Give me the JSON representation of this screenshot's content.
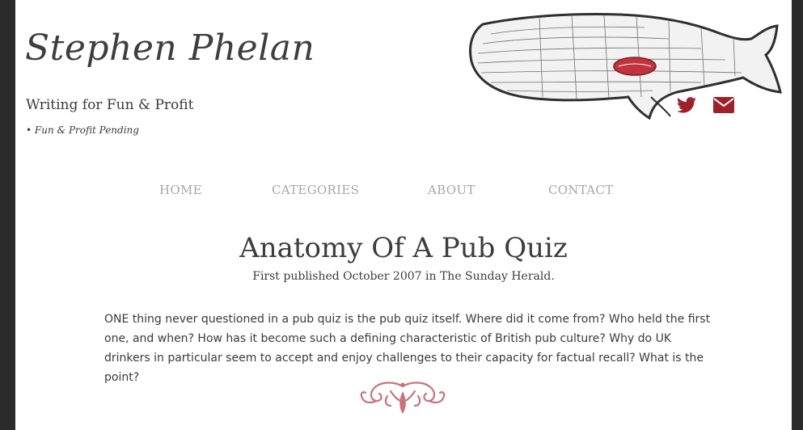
{
  "site": {
    "title": "Stephen Phelan",
    "tagline": "Writing for Fun & Profit",
    "tagnote": "• Fun & Profit Pending"
  },
  "social": [
    {
      "icon": "twitter-icon",
      "color": "#a0202a"
    },
    {
      "icon": "envelope-icon",
      "color": "#a0202a"
    }
  ],
  "nav": [
    {
      "label": "HOME"
    },
    {
      "label": "CATEGORIES"
    },
    {
      "label": "ABOUT"
    },
    {
      "label": "CONTACT"
    }
  ],
  "post": {
    "title": "Anatomy Of A Pub Quiz",
    "meta": "First published October 2007 in The Sunday Herald.",
    "body": "ONE thing never questioned in a pub quiz is the pub quiz itself. Where did it come from? Who held the first one, and when? How has it become such a defining characteristic of British pub culture? Why do UK drinkers in particular seem to accept and enjoy challenges to their capacity for factual recall? What is the point?"
  },
  "colors": {
    "accent": "#a0202a",
    "flourish": "#c9727b",
    "nav_text": "#a7a7a7",
    "body_text": "#3a3a3a",
    "frame": "#2b2b2b"
  }
}
